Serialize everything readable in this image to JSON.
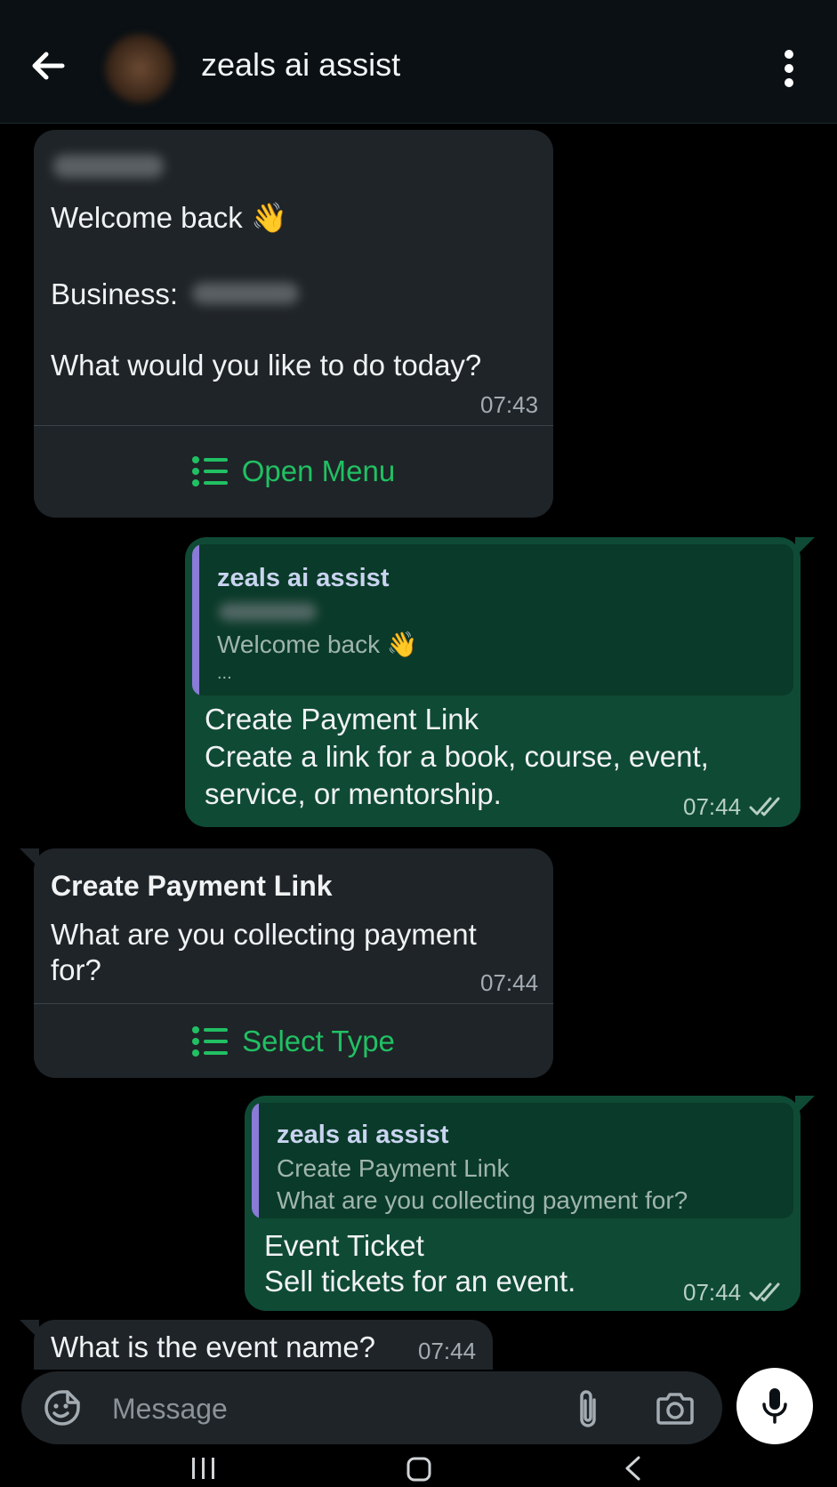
{
  "header": {
    "title": "zeals ai assist",
    "back_icon": "arrow-left-icon",
    "menu_icon": "more-vert-icon"
  },
  "messages": {
    "m1": {
      "line1": "Welcome back",
      "emoji": "👋",
      "business_label": "Business:",
      "question": "What would you like to do today?",
      "time": "07:43",
      "button_label": "Open Menu"
    },
    "m2": {
      "quote_name": "zeals ai assist",
      "quote_line1": "Welcome back",
      "quote_emoji": "👋",
      "quote_more": "...",
      "line1": "Create Payment Link",
      "line2": "Create a link for a book, course, event,",
      "line3": "service, or mentorship.",
      "time": "07:44"
    },
    "m3": {
      "title": "Create Payment Link",
      "line1": "What are you collecting payment",
      "line2": "for?",
      "time": "07:44",
      "button_label": "Select Type"
    },
    "m4": {
      "quote_name": "zeals ai assist",
      "quote_line1": "Create Payment Link",
      "quote_line2": "What are you collecting payment for?",
      "line1": "Event Ticket",
      "line2": "Sell tickets for an event.",
      "time": "07:44"
    },
    "m5": {
      "text": "What is the event name?",
      "time": "07:44"
    }
  },
  "composer": {
    "placeholder": "Message"
  },
  "colors": {
    "accent": "#21c063",
    "outgoing_bubble": "#0f4a35",
    "incoming_bubble": "#1f2428",
    "quote_bar": "#8a7bd8"
  }
}
